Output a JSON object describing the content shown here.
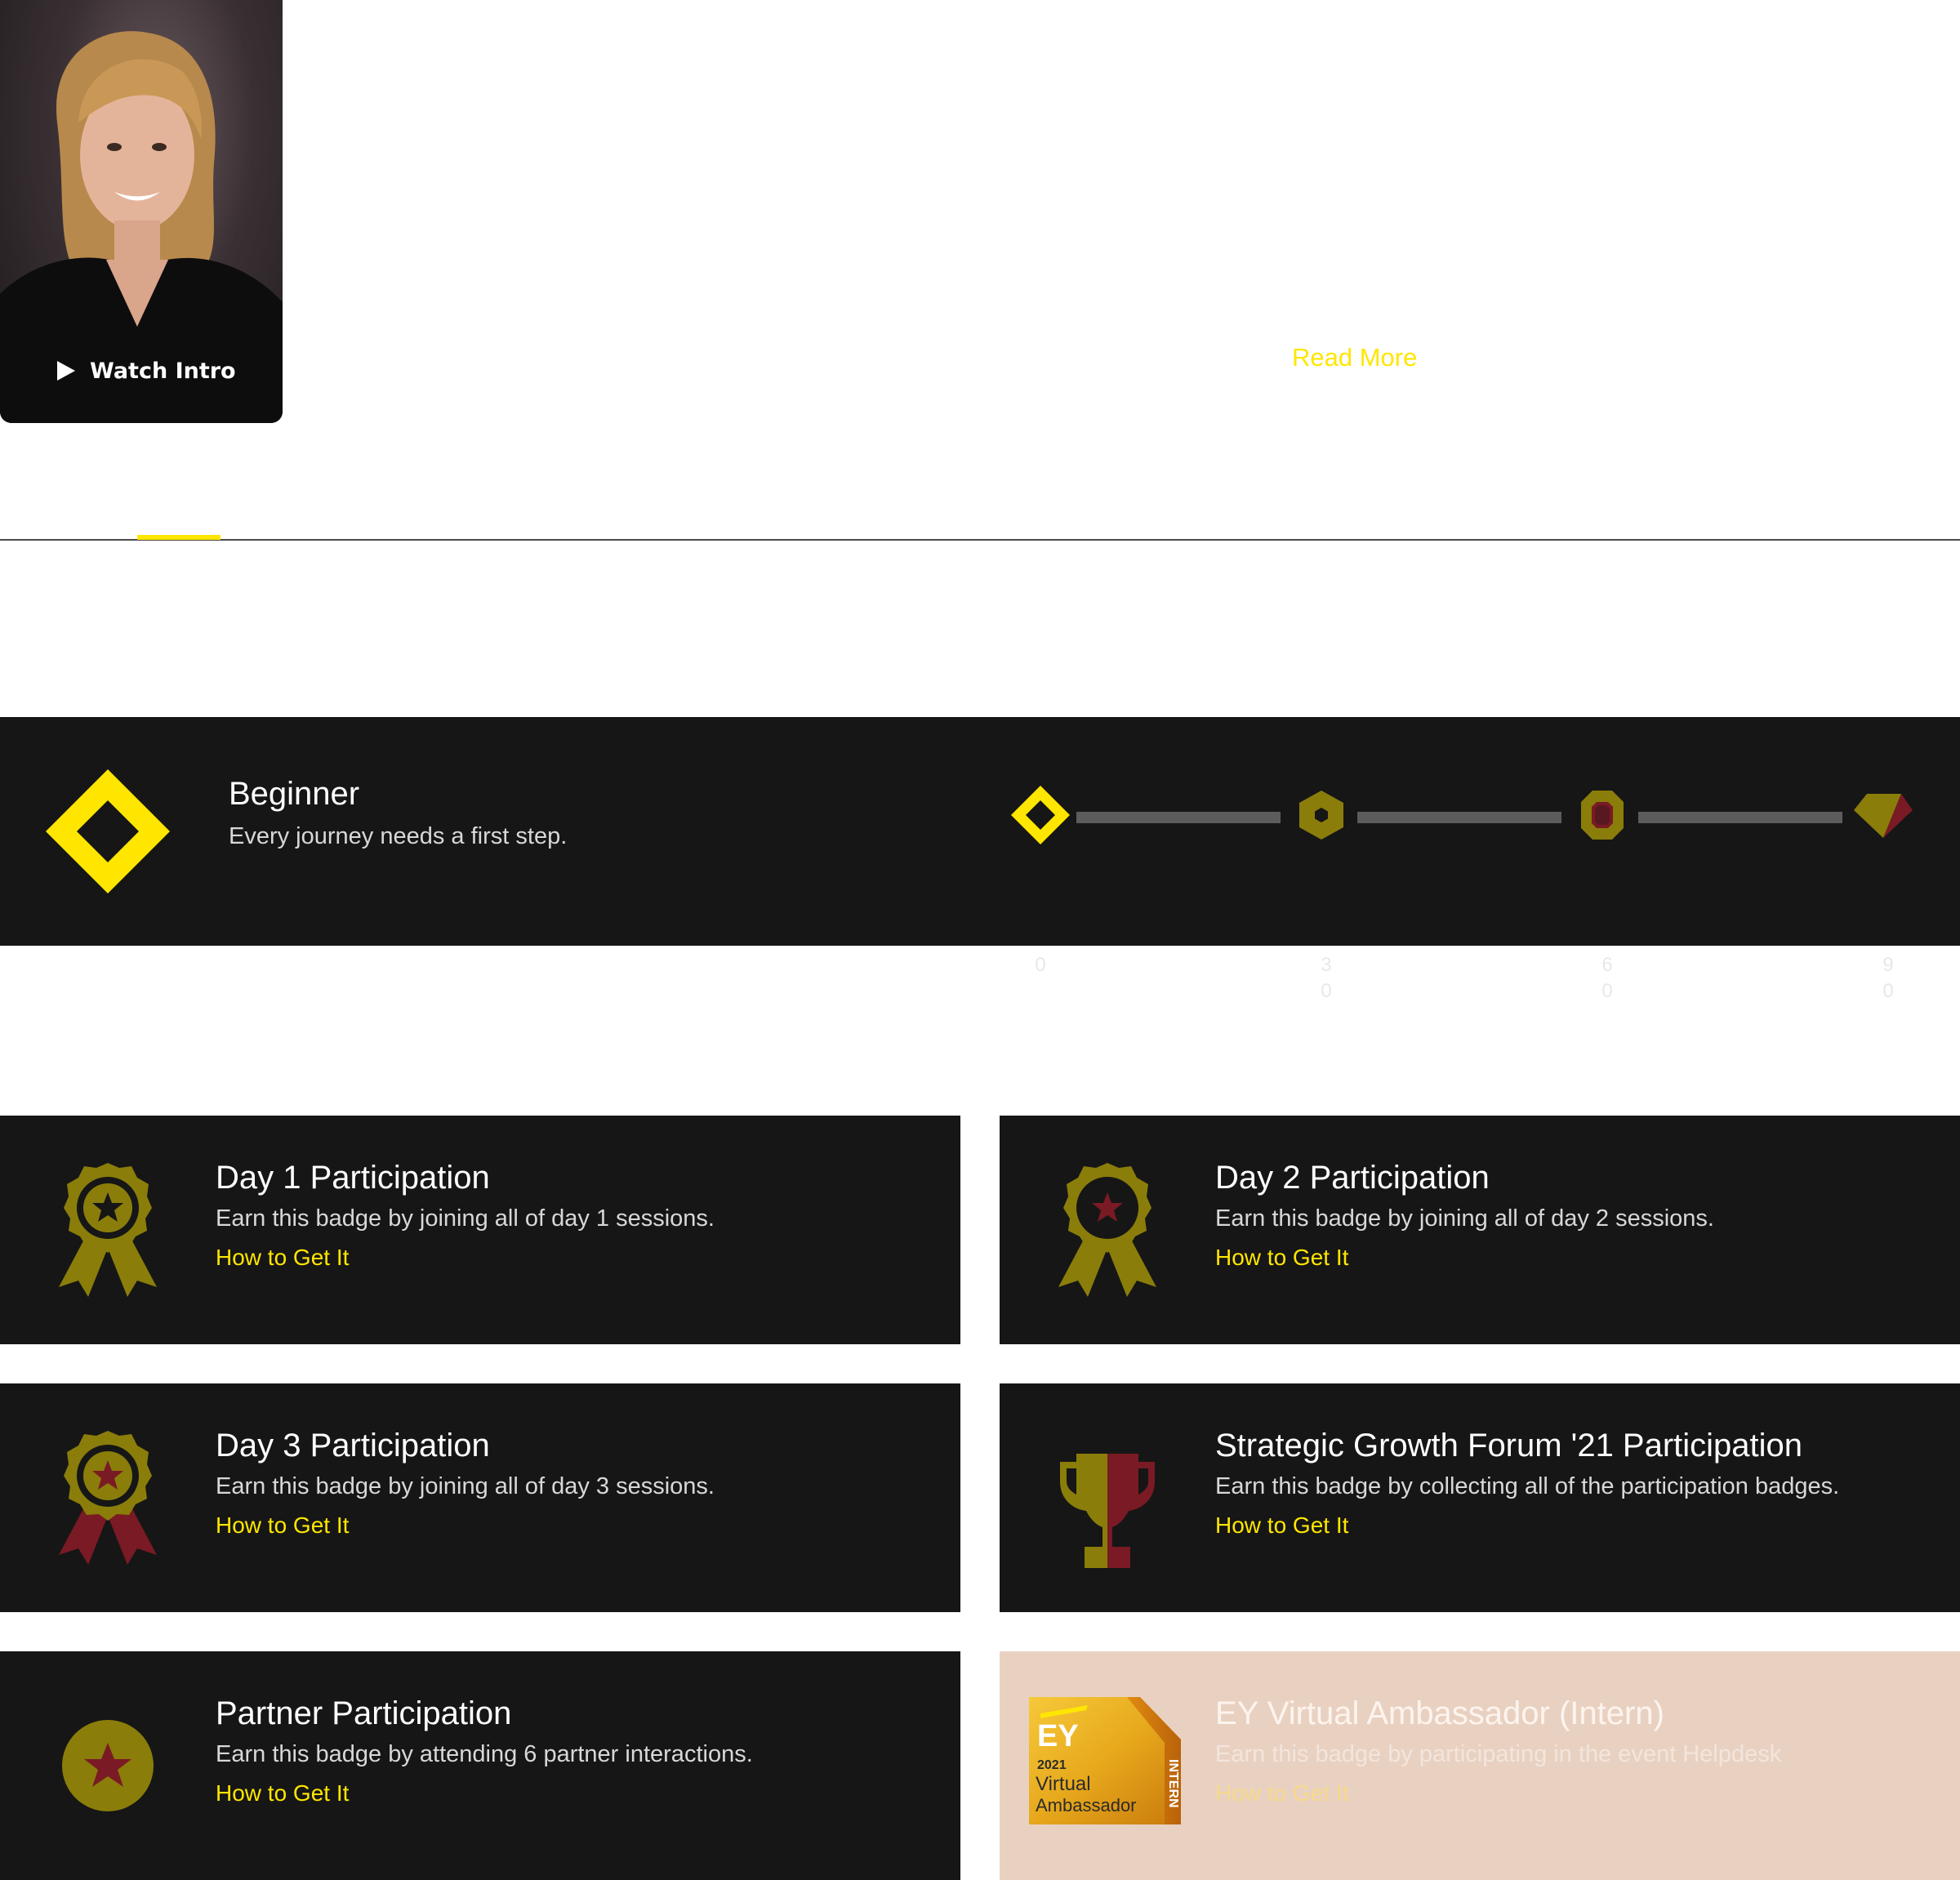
{
  "profile": {
    "watch_intro_label": "Watch Intro",
    "read_more_label": "Read More"
  },
  "level": {
    "title": "Beginner",
    "subtitle": "Every journey needs a first step.",
    "milestones": [
      "0",
      "30",
      "60",
      "90"
    ],
    "current_points": 0
  },
  "badges": [
    {
      "title": "Day 1 Participation",
      "description": "Earn this badge by joining all of day 1 sessions.",
      "link": "How to Get It",
      "icon": "ribbon-medal-icon"
    },
    {
      "title": "Day 2 Participation",
      "description": "Earn this badge by joining all of day 2 sessions.",
      "link": "How to Get It",
      "icon": "ribbon-medal-icon"
    },
    {
      "title": "Day 3 Participation",
      "description": "Earn this badge by joining all of day 3 sessions.",
      "link": "How to Get It",
      "icon": "ribbon-medal-icon"
    },
    {
      "title": "Strategic Growth Forum '21 Participation",
      "description": "Earn this badge by collecting all of the participation badges.",
      "link": "How to Get It",
      "icon": "trophy-icon"
    },
    {
      "title": "Partner Participation",
      "description": "Earn this badge by attending 6 partner interactions.",
      "link": "How to Get It",
      "icon": "star-coin-icon"
    },
    {
      "title": "EY Virtual Ambassador (Intern)",
      "description": "Earn this badge by participating in the event Helpdesk",
      "link": "How to Get It",
      "icon": "ey-ambassador-badge-icon",
      "badge_art": {
        "brand": "EY",
        "year": "2021",
        "line1": "Virtual",
        "line2": "Ambassador",
        "side": "INTERN"
      }
    }
  ],
  "colors": {
    "accent": "#ffe600",
    "card_bg": "#161616",
    "badge_olive": "#8a7d0a",
    "badge_maroon": "#7a1a24",
    "locked_bg": "#e9d1c2"
  }
}
